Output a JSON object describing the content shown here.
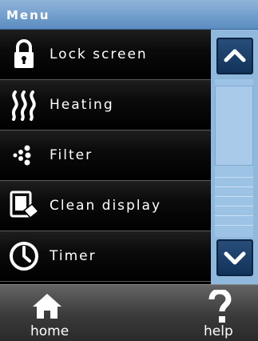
{
  "title": "Menu",
  "menu": {
    "items": [
      {
        "label": "Lock screen",
        "icon": "lock-icon"
      },
      {
        "label": "Heating",
        "icon": "heating-icon"
      },
      {
        "label": "Filter",
        "icon": "filter-icon"
      },
      {
        "label": "Clean display",
        "icon": "clean-display-icon"
      },
      {
        "label": "Timer",
        "icon": "timer-icon"
      }
    ]
  },
  "scrollbar": {
    "up_icon": "chevron-up-icon",
    "down_icon": "chevron-down-icon"
  },
  "footer": {
    "home_label": "home",
    "help_label": "help"
  },
  "colors": {
    "title_bar": "#6f9dcc",
    "scroll_bar": "#8fb8dc",
    "scroll_button": "#1b3f69"
  }
}
